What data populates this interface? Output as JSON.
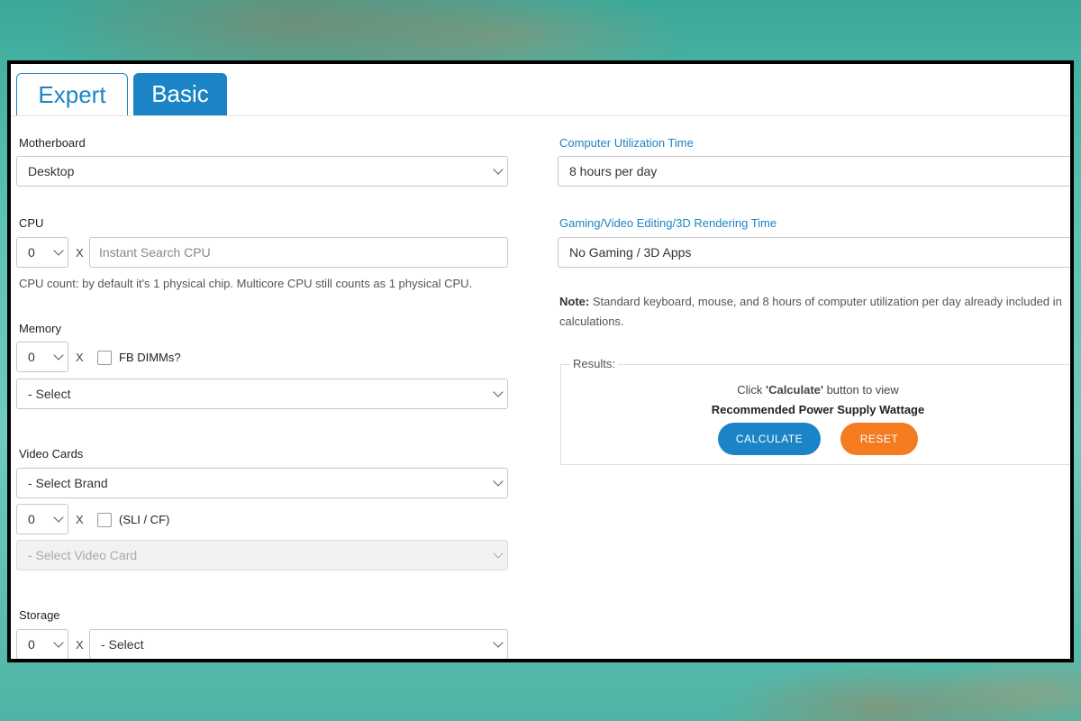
{
  "tabs": {
    "expert": "Expert",
    "basic": "Basic"
  },
  "left": {
    "motherboard": {
      "label": "Motherboard",
      "value": "Desktop"
    },
    "cpu": {
      "label": "CPU",
      "count": "0",
      "times": "X",
      "placeholder": "Instant Search CPU",
      "help": "CPU count: by default it's 1 physical chip. Multicore CPU still counts as 1 physical CPU."
    },
    "memory": {
      "label": "Memory",
      "count": "0",
      "times": "X",
      "checkbox_label": "FB DIMMs?",
      "select": "- Select"
    },
    "video": {
      "label": "Video Cards",
      "brand": "- Select Brand",
      "count": "0",
      "times": "X",
      "checkbox_label": "(SLI / CF)",
      "card": "- Select Video Card"
    },
    "storage": {
      "label": "Storage",
      "count": "0",
      "times": "X",
      "select": "- Select"
    }
  },
  "right": {
    "utilization": {
      "label": "Computer Utilization Time",
      "value": "8 hours per day"
    },
    "gaming": {
      "label": "Gaming/Video Editing/3D Rendering Time",
      "value": "No Gaming / 3D Apps"
    },
    "note_bold": "Note:",
    "note_text": " Standard keyboard, mouse, and 8 hours of computer utilization per day already included in calculations.",
    "results": {
      "legend": "Results:",
      "line1_pre": "Click ",
      "line1_bold": "'Calculate'",
      "line1_post": " button to view",
      "line2": "Recommended Power Supply Wattage",
      "calculate": "CALCULATE",
      "reset": "RESET"
    }
  },
  "colors": {
    "accent": "#1b84c6",
    "reset": "#f47b20"
  }
}
